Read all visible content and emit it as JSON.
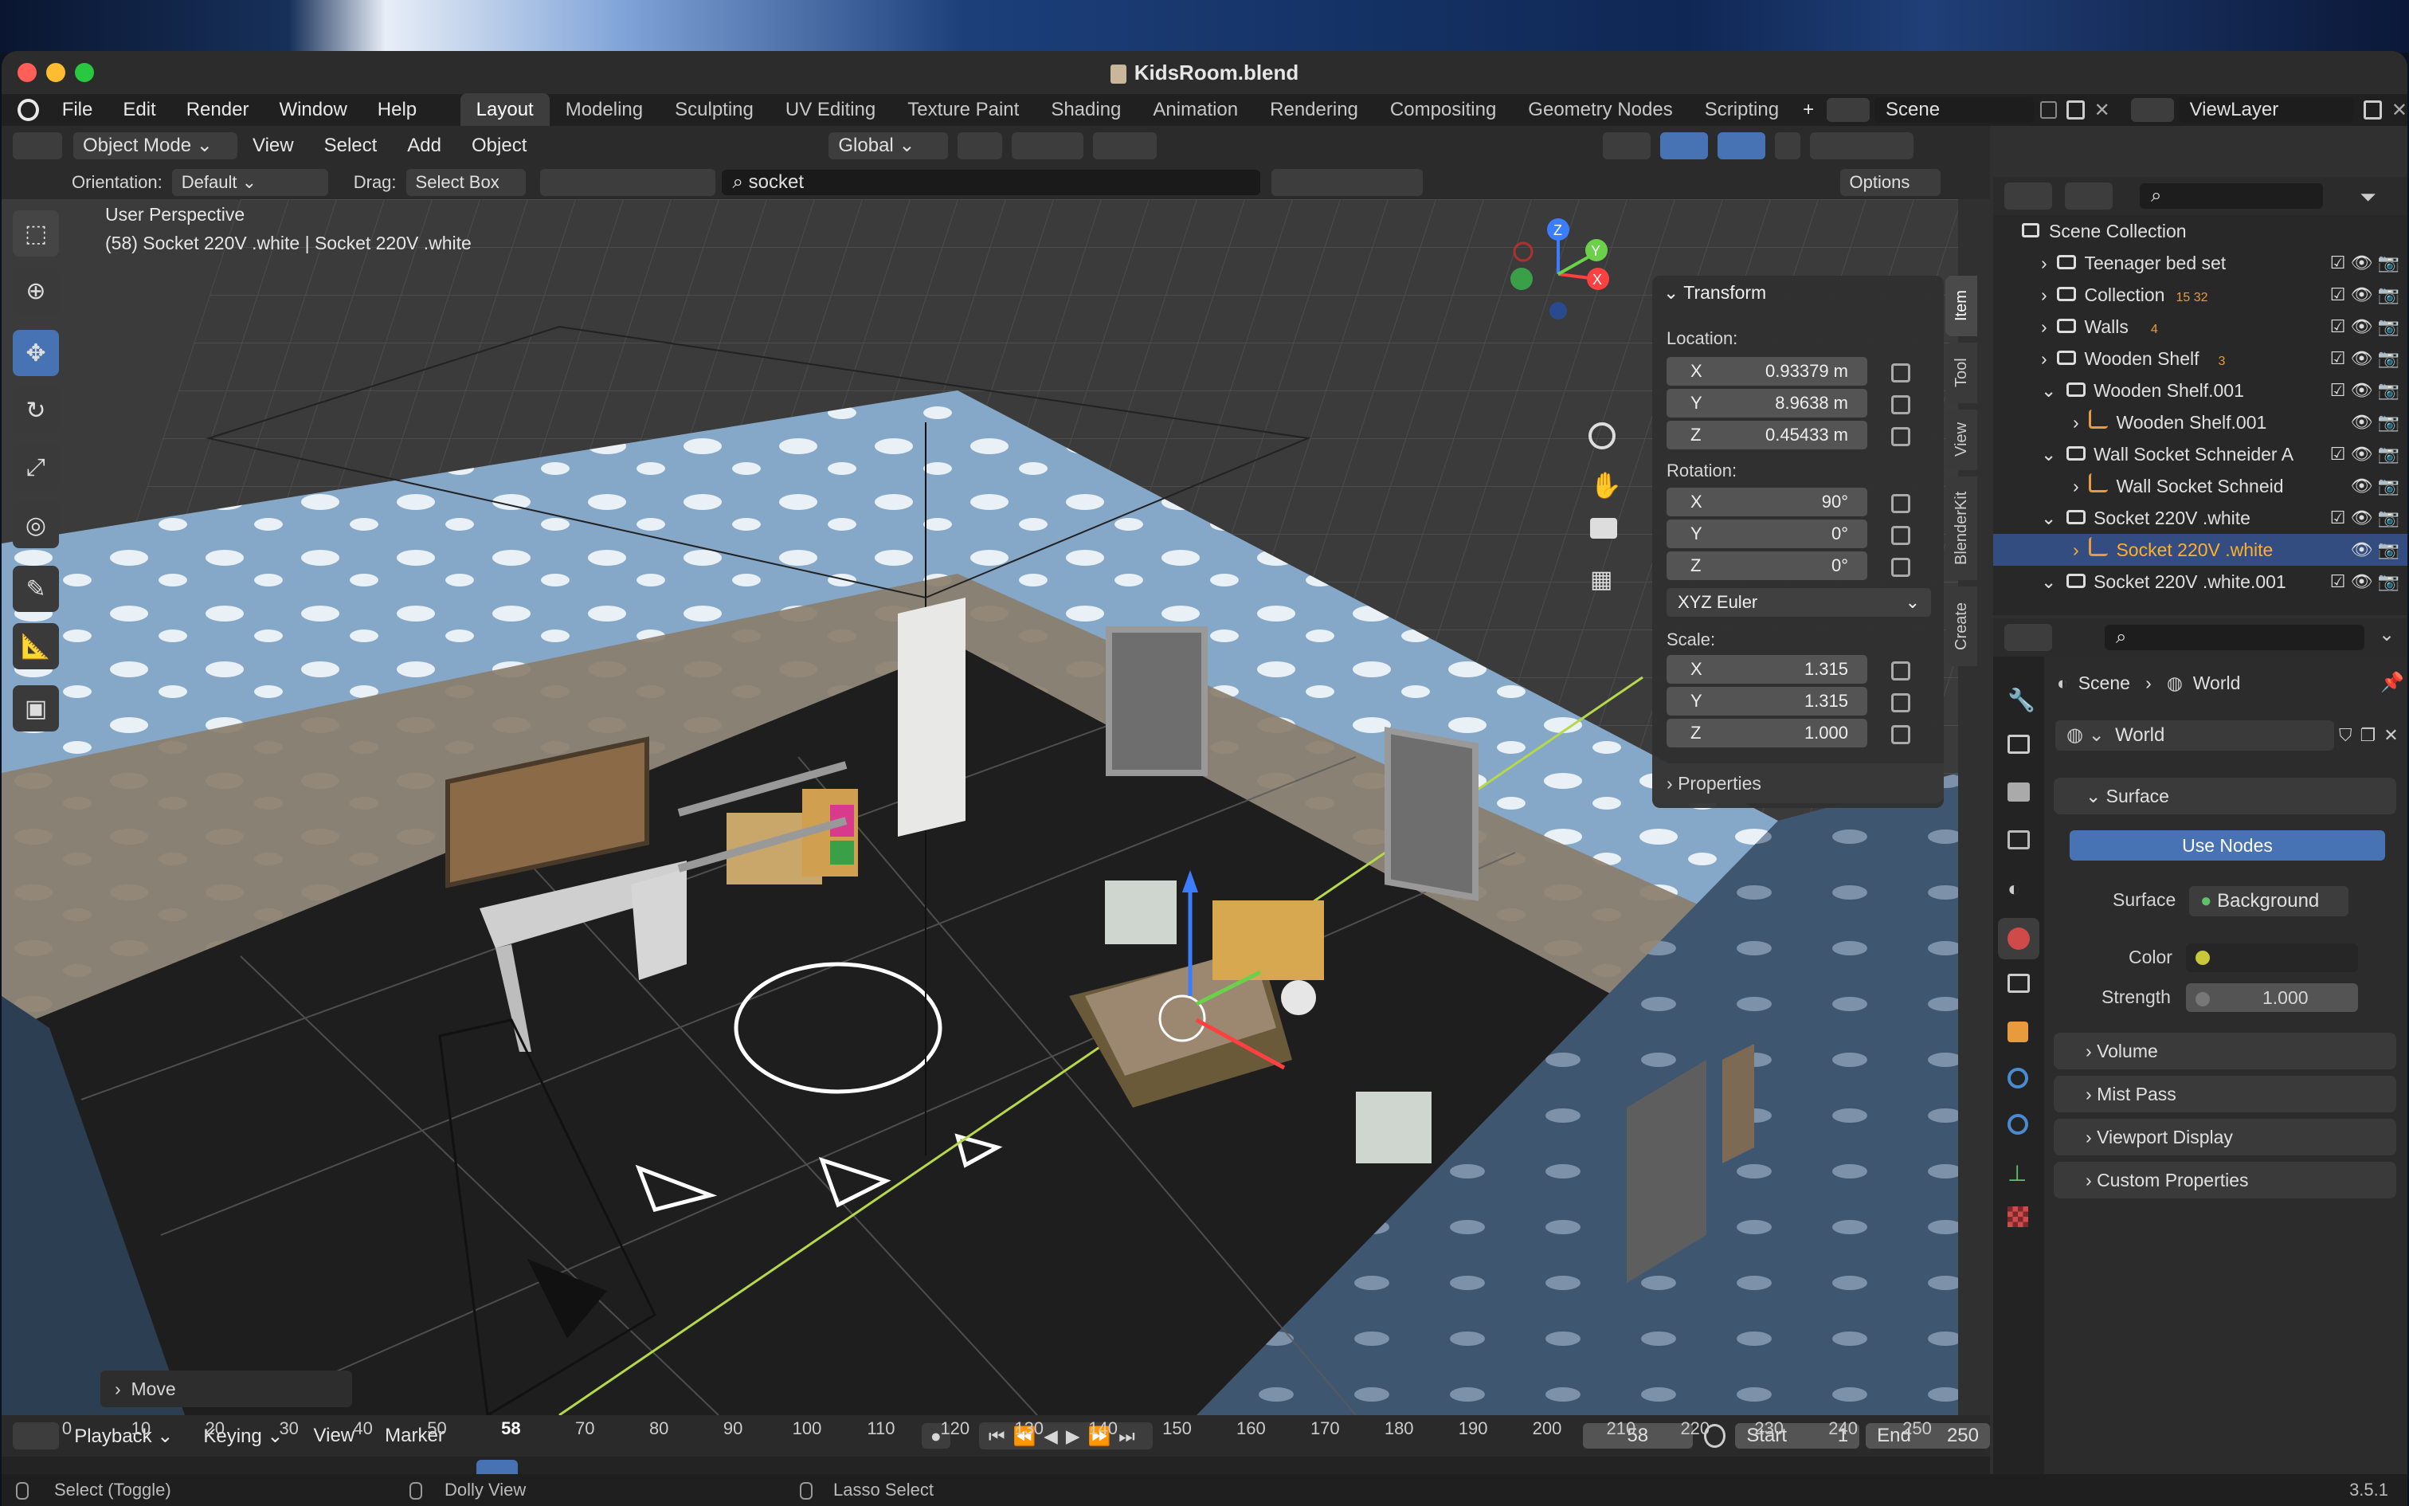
{
  "window": {
    "title": "KidsRoom.blend"
  },
  "menu": [
    "File",
    "Edit",
    "Render",
    "Window",
    "Help"
  ],
  "workspaces": [
    "Layout",
    "Modeling",
    "Sculpting",
    "UV Editing",
    "Texture Paint",
    "Shading",
    "Animation",
    "Rendering",
    "Compositing",
    "Geometry Nodes",
    "Scripting"
  ],
  "scene_field": "Scene",
  "viewlayer_field": "ViewLayer",
  "header": {
    "mode": "Object Mode",
    "view": "View",
    "select": "Select",
    "add": "Add",
    "object": "Object",
    "transform_orientation": "Global"
  },
  "header2": {
    "orientation_label": "Orientation:",
    "orientation_value": "Default",
    "drag_label": "Drag:",
    "drag_value": "Select Box",
    "search_value": "socket",
    "options": "Options"
  },
  "viewport": {
    "perspective": "User Perspective",
    "active_info": "(58) Socket 220V .white | Socket 220V .white",
    "last_op": "Move"
  },
  "transform": {
    "title": "Transform",
    "location_label": "Location:",
    "location": {
      "x": "0.93379 m",
      "y": "8.9638 m",
      "z": "0.45433 m"
    },
    "rotation_label": "Rotation:",
    "rotation": {
      "x": "90°",
      "y": "0°",
      "z": "0°"
    },
    "rotation_mode": "XYZ Euler",
    "scale_label": "Scale:",
    "scale": {
      "x": "1.315",
      "y": "1.315",
      "z": "1.000"
    },
    "properties": "Properties"
  },
  "side_tabs": [
    "Item",
    "Tool",
    "View",
    "BlenderKit",
    "Create"
  ],
  "axes": {
    "x": "X",
    "y": "Y",
    "z": "Z"
  },
  "outliner": {
    "root": "Scene Collection",
    "items": [
      {
        "name": "Teenager bed set",
        "badge": ""
      },
      {
        "name": "Collection",
        "badge": "15 32"
      },
      {
        "name": "Walls",
        "badge": "4"
      },
      {
        "name": "Wooden Shelf",
        "badge": "3"
      },
      {
        "name": "Wooden Shelf.001",
        "badge": ""
      },
      {
        "name": "Wooden Shelf.001",
        "badge": ""
      },
      {
        "name": "Wall Socket Schneider A",
        "badge": ""
      },
      {
        "name": "Wall Socket Schneid",
        "badge": ""
      },
      {
        "name": "Socket 220V .white",
        "badge": ""
      },
      {
        "name": "Socket 220V .white",
        "badge": ""
      },
      {
        "name": "Socket 220V .white.001",
        "badge": ""
      }
    ]
  },
  "properties": {
    "breadcrumb_scene": "Scene",
    "breadcrumb_world": "World",
    "world_name": "World",
    "surface": "Surface",
    "use_nodes": "Use Nodes",
    "surface_label": "Surface",
    "surface_value": "Background",
    "color_label": "Color",
    "strength_label": "Strength",
    "strength_value": "1.000",
    "sections": [
      "Volume",
      "Mist Pass",
      "Viewport Display",
      "Custom Properties"
    ]
  },
  "timeline": {
    "playback": "Playback",
    "keying": "Keying",
    "view": "View",
    "marker": "Marker",
    "current_frame": "58",
    "start_label": "Start",
    "start": "1",
    "end_label": "End",
    "end": "250",
    "ticks": [
      "0",
      "10",
      "20",
      "30",
      "40",
      "50",
      "58",
      "70",
      "80",
      "90",
      "100",
      "110",
      "120",
      "130",
      "140",
      "150",
      "160",
      "170",
      "180",
      "190",
      "200",
      "210",
      "220",
      "230",
      "240",
      "250"
    ]
  },
  "status": {
    "select": "Select (Toggle)",
    "dolly": "Dolly View",
    "lasso": "Lasso Select",
    "version": "3.5.1"
  }
}
